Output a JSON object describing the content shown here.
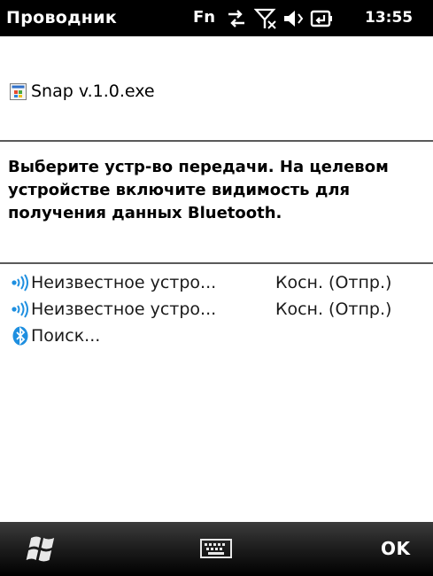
{
  "status_bar": {
    "app_title": "Проводник",
    "fn_indicator": "Fn",
    "time": "13:55",
    "icons": [
      "data-transfer-icon",
      "no-signal-icon",
      "volume-icon",
      "battery-charging-icon"
    ]
  },
  "file": {
    "name": "Snap v.1.0.exe",
    "icon": "executable-file-icon"
  },
  "instruction": {
    "text": "Выберите устр-во передачи. На целевом устройстве включите видимость для получения данных Bluetooth."
  },
  "devices": [
    {
      "name": "Неизвестное устро...",
      "status": "Косн. (Отпр.)",
      "icon": "beam-device-icon"
    },
    {
      "name": "Неизвестное устро...",
      "status": "Косн. (Отпр.)",
      "icon": "beam-device-icon"
    },
    {
      "name": "Поиск...",
      "status": "",
      "icon": "bluetooth-icon"
    }
  ],
  "softkeys": {
    "start_icon": "windows-start-icon",
    "keyboard_icon": "keyboard-icon",
    "right_label": "OK"
  },
  "colors": {
    "status_bar_bg": "#000000",
    "accent_blue": "#1e8fe0",
    "divider": "#5a5a5a"
  }
}
